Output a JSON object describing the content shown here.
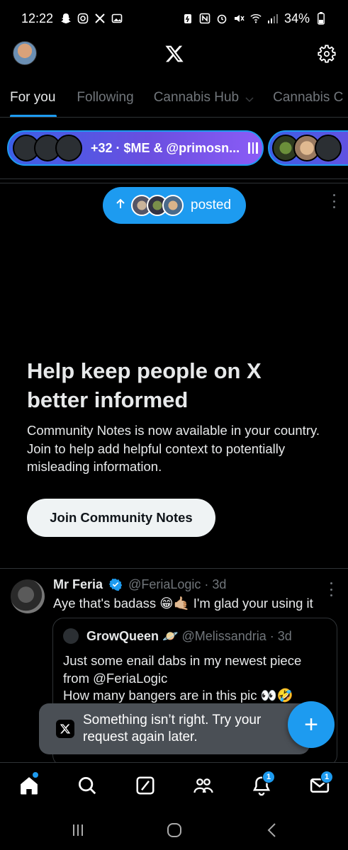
{
  "status_bar": {
    "time": "12:22",
    "battery": "34%"
  },
  "header": {
    "logo": "x-logo"
  },
  "tabs": [
    {
      "label": "For you",
      "active": true
    },
    {
      "label": "Following",
      "active": false
    },
    {
      "label": "Cannabis Hub",
      "active": false
    },
    {
      "label": "Cannabis C",
      "active": false
    }
  ],
  "spaces": {
    "space1_text": "+32 · $ME & @primosn..."
  },
  "posted_pill": {
    "label": "posted"
  },
  "community_notes": {
    "title": "Help keep people on X better informed",
    "body": "Community Notes is now available in your country. Join to help add helpful context to potentially misleading information.",
    "button": "Join Community Notes"
  },
  "tweet": {
    "name": "Mr Feria",
    "handle": "@FeriaLogic",
    "time": "· 3d",
    "text": "Aye that's badass 😁🤙🏼 I'm glad your using it",
    "quote": {
      "name": "GrowQueen 🪐",
      "handle": "@Melissandria",
      "time": "· 3d",
      "text_line1": "Just some enail dabs in my newest piece",
      "text_line2": "from @FeriaLogic",
      "text_line3": "How many bangers are in this pic 👀🤣"
    }
  },
  "toast": {
    "text": "Something isn’t right. Try your request again later."
  },
  "fab": {
    "label": "+"
  },
  "bottom_nav": {
    "notifications_badge": "1",
    "messages_badge": "1"
  },
  "colors": {
    "accent": "#1d9bf0",
    "background": "#000000",
    "text": "#e7e9ea",
    "muted": "#71767b",
    "border": "#2f3336",
    "toast_bg": "#4a4f55"
  }
}
